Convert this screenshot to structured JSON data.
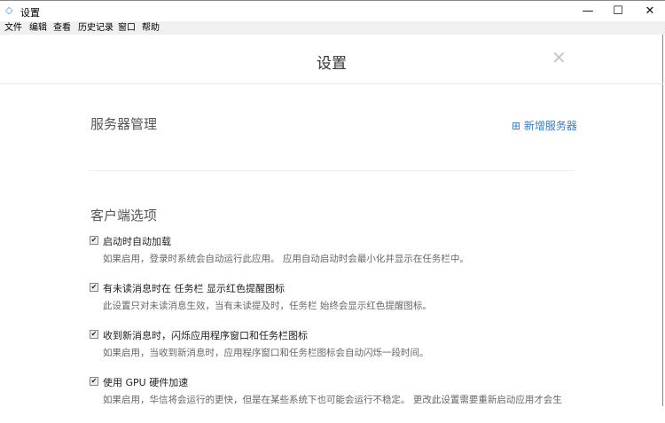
{
  "window": {
    "title": "设置",
    "minimize": "—",
    "maximize": "☐",
    "close": "✕"
  },
  "menu": [
    "文件",
    "编辑",
    "查看",
    "历史记录",
    "窗口",
    "帮助"
  ],
  "page": {
    "title": "设置",
    "close": "✕"
  },
  "servers": {
    "title": "服务器管理",
    "add_label": "新增服务器",
    "add_icon": "⊞"
  },
  "client": {
    "title": "客户端选项",
    "options": [
      {
        "label": "启动时自动加载",
        "desc": "如果启用，登录时系统会自动运行此应用。 应用自动启动时会最小化并显示在任务栏中。",
        "checked": true
      },
      {
        "label": "有未读消息时在 任务栏 显示红色提醒图标",
        "desc": "此设置只对未读消息生效，当有未读提及时，任务栏 始终会显示红色提醒图标。",
        "checked": true
      },
      {
        "label": "收到新消息时，闪烁应用程序窗口和任务栏图标",
        "desc": "如果启用，当收到新消息时，应用程序窗口和任务栏图标会自动闪烁一段时间。",
        "checked": true
      },
      {
        "label": "使用 GPU 硬件加速",
        "desc": "如果启用，华信将会运行的更快，但是在某些系统下也可能会运行不稳定。 更改此设置需要重新启动应用才会生",
        "checked": true
      }
    ]
  }
}
